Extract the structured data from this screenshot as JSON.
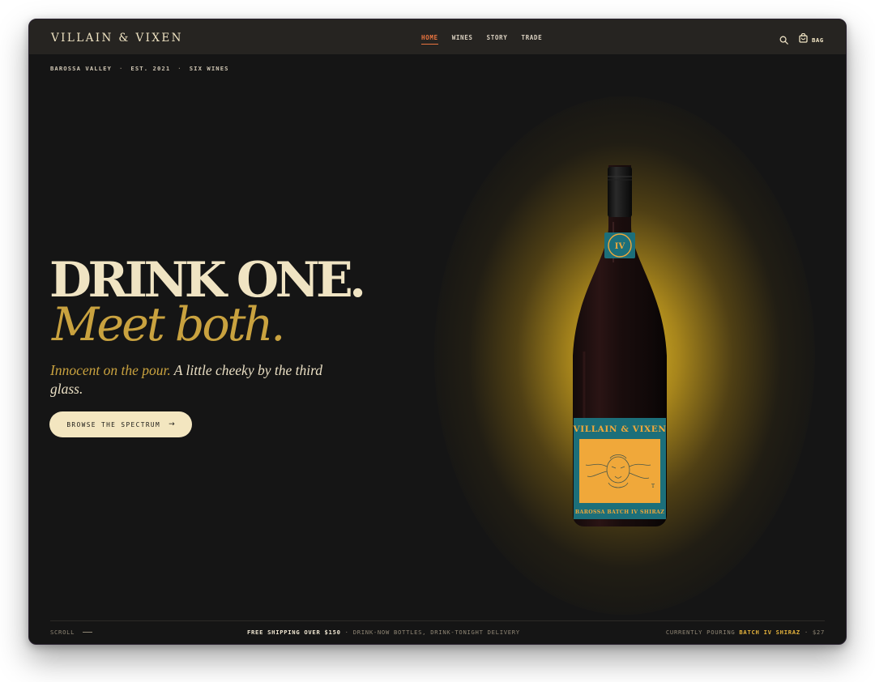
{
  "brand": {
    "name": "VILLAIN & VIXEN"
  },
  "nav": {
    "items": [
      {
        "label": "HOME",
        "active": true
      },
      {
        "label": "WINES",
        "active": false
      },
      {
        "label": "STORY",
        "active": false
      },
      {
        "label": "TRADE",
        "active": false
      }
    ],
    "bag_label": "BAG",
    "search_icon": "search-icon",
    "bag_icon": "bag-icon"
  },
  "meta": {
    "region": "BAROSSA VALLEY",
    "sep": "·",
    "established": "EST. 2021",
    "count": "SIX WINES"
  },
  "hero": {
    "headline_line1": "DRINK ONE.",
    "headline_line2": "Meet both.",
    "tagline_accent": "Innocent on the pour.",
    "tagline_rest": " A little cheeky by the third glass.",
    "cta_label": "BROWSE THE SPECTRUM",
    "cta_arrow": "→"
  },
  "bottle": {
    "label_brand": "VILLAIN & VIXEN",
    "label_product": "BAROSSA BATCH IV SHIRAZ",
    "label_mark": "IV"
  },
  "footer": {
    "scroll_label": "SCROLL",
    "shipping_strong": "FREE SHIPPING OVER $150",
    "shipping_rest": " · DRINK-NOW BOTTLES, DRINK-TONIGHT DELIVERY",
    "pouring_prefix": "CURRENTLY POURING ",
    "pouring_wine": "BATCH IV SHIRAZ",
    "pouring_price": " · $27"
  },
  "colors": {
    "background": "#151515",
    "cream": "#f0e4c3",
    "gold": "#c9a23f",
    "nav_active": "#e9743f",
    "label_teal": "#1c6f7a",
    "label_orange": "#f0a83a"
  }
}
